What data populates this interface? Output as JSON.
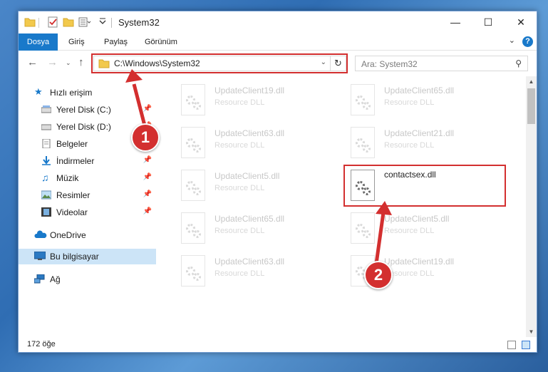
{
  "window": {
    "title": "System32"
  },
  "ribbon": {
    "tabs": [
      "Dosya",
      "Giriş",
      "Paylaş",
      "Görünüm"
    ],
    "help": "?"
  },
  "navigation": {
    "address": "C:\\Windows\\System32",
    "search_placeholder": "Ara: System32"
  },
  "sidebar": {
    "quick_access": "Hızlı erişim",
    "items": [
      {
        "label": "Yerel Disk (C:)",
        "icon": "drive-icon",
        "pinned": true
      },
      {
        "label": "Yerel Disk (D:)",
        "icon": "drive-icon",
        "pinned": true
      },
      {
        "label": "Belgeler",
        "icon": "document-icon",
        "pinned": true
      },
      {
        "label": "İndirmeler",
        "icon": "download-icon",
        "pinned": true
      },
      {
        "label": "Müzik",
        "icon": "music-icon",
        "pinned": true
      },
      {
        "label": "Resimler",
        "icon": "pictures-icon",
        "pinned": true
      },
      {
        "label": "Videolar",
        "icon": "video-icon",
        "pinned": true
      }
    ],
    "onedrive": "OneDrive",
    "this_pc": "Bu bilgisayar",
    "network": "Ağ"
  },
  "files": [
    {
      "name": "UpdateClient19.dll",
      "type": "Resource DLL",
      "faded": true
    },
    {
      "name": "UpdateClient65.dll",
      "type": "Resource DLL",
      "faded": true
    },
    {
      "name": "UpdateClient63.dll",
      "type": "Resource DLL",
      "faded": true
    },
    {
      "name": "UpdateClient21.dll",
      "type": "Resource DLL",
      "faded": true
    },
    {
      "name": "UpdateClient5.dll",
      "type": "Resource DLL",
      "faded": true
    },
    {
      "name": "contactsex.dll",
      "type": "",
      "faded": false
    },
    {
      "name": "UpdateClient65.dll",
      "type": "Resource DLL",
      "faded": true
    },
    {
      "name": "UpdateClient5.dll",
      "type": "Resource DLL",
      "faded": true
    },
    {
      "name": "UpdateClient63.dll",
      "type": "Resource DLL",
      "faded": true
    },
    {
      "name": "UpdateClient19.dll",
      "type": "Resource DLL",
      "faded": true
    }
  ],
  "status": {
    "item_count": "172 öğe"
  },
  "annotations": {
    "step1": "1",
    "step2": "2",
    "highlight_color": "#d32f2f"
  }
}
